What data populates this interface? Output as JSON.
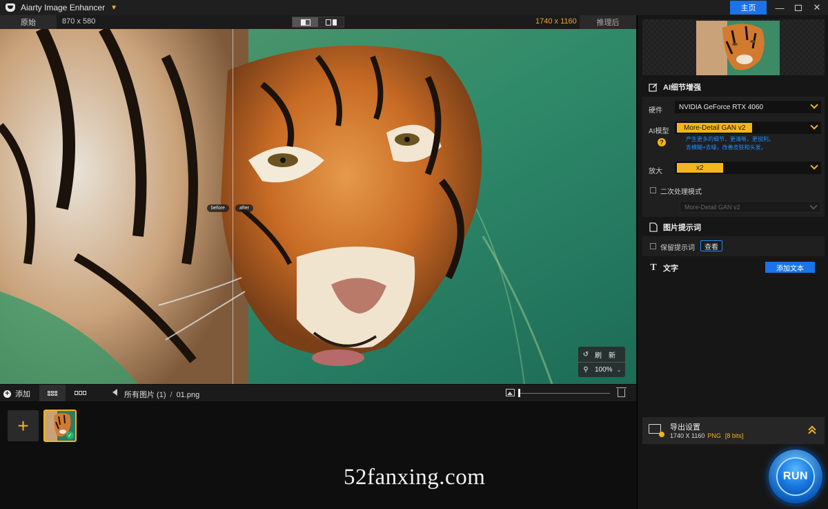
{
  "app": {
    "title": "Aiarty Image Enhancer",
    "home_label": "主页",
    "window_controls": [
      "minimize-icon",
      "maximize-icon",
      "close-icon"
    ]
  },
  "viewer": {
    "original_label": "原始",
    "original_size": "870 x 580",
    "enhanced_size": "1740 x 1160",
    "after_label": "推理后",
    "compare_modes": [
      "split-view-icon",
      "side-by-side-icon"
    ],
    "before_tag": "before",
    "after_tag": "after",
    "refresh_label": "刷　新",
    "zoom": "100%"
  },
  "strip": {
    "add_label": "添加",
    "breadcrumb_root": "所有图片 (1)",
    "breadcrumb_sep": "/",
    "breadcrumb_file": "01.png"
  },
  "watermark": "52fanxing.com",
  "panel": {
    "detail_section": "AI细节增强",
    "hardware_label": "硬件",
    "hardware_value": "NVIDIA GeForce RTX 4060",
    "model_label": "AI模型",
    "model_value": "More-Detail GAN v2",
    "model_desc_line1": "产生更多的细节，更清晰，更锐利。",
    "model_desc_line2": "去模糊+去噪，改善皮肤和头发。",
    "upscale_label": "放大",
    "upscale_value": "x2",
    "second_pass_label": "二次处理模式",
    "second_pass_model": "More-Detail GAN v2",
    "prompt_section": "图片提示词",
    "keep_prompt_label": "保留提示词",
    "view_button": "查看",
    "text_section": "文字",
    "add_text_button": "添加文本",
    "export_title": "导出设置",
    "export_size": "1740 X 1160",
    "export_format": "PNG",
    "export_bits": "[8 bits]",
    "run_label": "RUN"
  },
  "colors": {
    "accent": "#f5b51b",
    "primary_blue": "#1a73e8",
    "link_blue": "#1e8fff",
    "enhanced_size_color": "#f5a623"
  }
}
